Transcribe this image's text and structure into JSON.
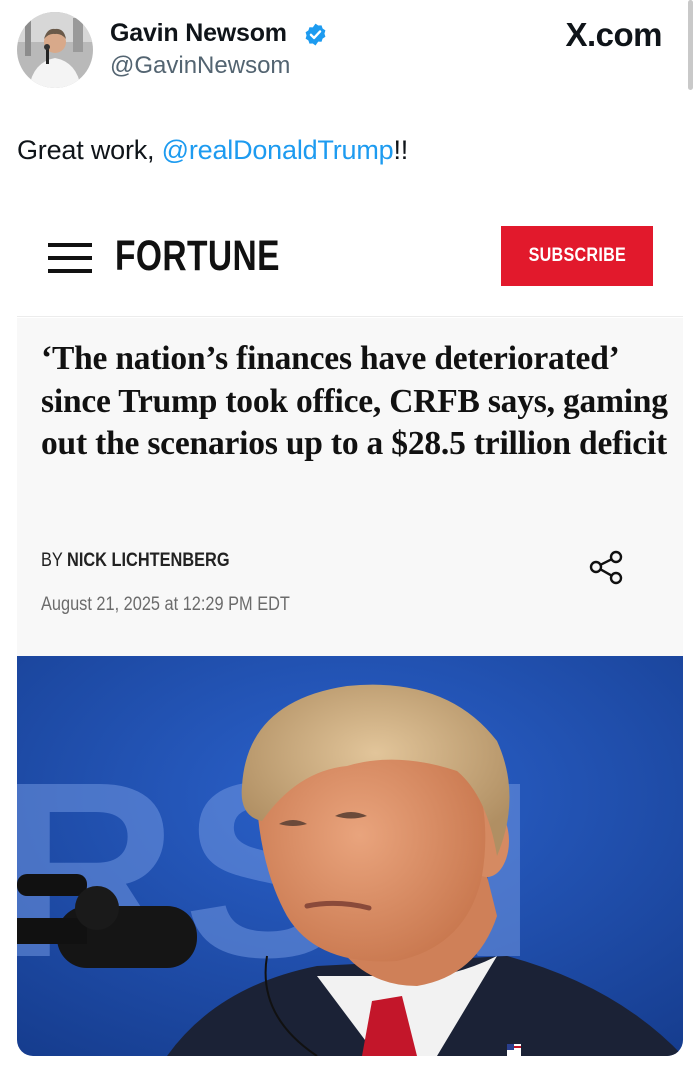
{
  "tweet": {
    "display_name": "Gavin Newsom",
    "handle": "@GavinNewsom",
    "site": "X.com",
    "text_prefix": "Great work, ",
    "mention": "@realDonaldTrump",
    "text_suffix": "!!"
  },
  "card": {
    "logo": "FORTUNE",
    "subscribe_label": "SUBSCRIBE",
    "headline": "‘The nation’s finances have deteriorated’ since Trump took office, CRFB says, gaming out the scenarios up to a $28.5 trillion deficit",
    "byline_prefix": "BY ",
    "author": "NICK LICHTENBERG",
    "date": "August 21, 2025 at 12:29 PM EDT",
    "photo_backdrop_letters": "RSN"
  },
  "colors": {
    "mention": "#1d9bf0",
    "verified": "#1d9bf0",
    "subscribe_bg": "#e2192c",
    "photo_bg": "#1f4fb0"
  },
  "icons": [
    "verified-badge-icon",
    "hamburger-menu-icon",
    "share-icon"
  ]
}
